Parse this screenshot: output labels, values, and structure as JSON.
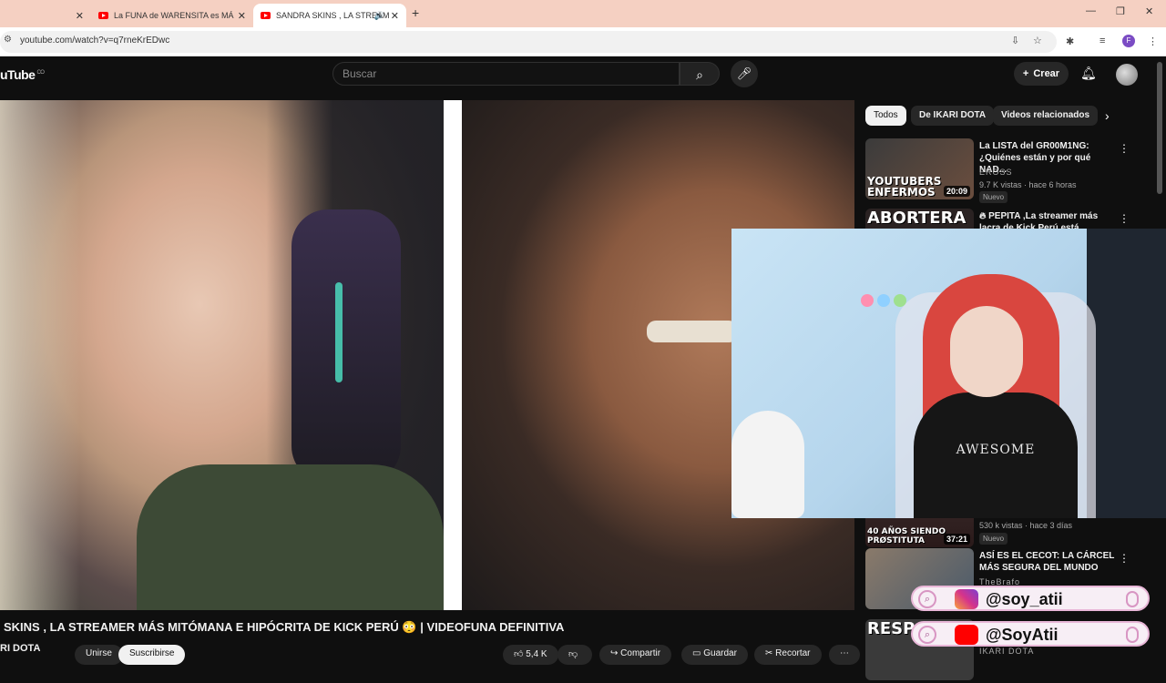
{
  "browser": {
    "tabs": [
      {
        "title": "La FUNA de WARENSITA es MÁ"
      },
      {
        "title": "SANDRA SKINS , LA STREAM"
      }
    ],
    "url": "youtube.com/watch?v=q7rneKrEDwc",
    "profile_initial": "F"
  },
  "header": {
    "logo": "uTube",
    "country": "CO",
    "search_placeholder": "Buscar",
    "create_label": "Crear"
  },
  "video": {
    "title": "SKINS , LA STREAMER MÁS MITÓMANA E HIPÓCRITA DE KICK PERÚ 😳 | VIDEOFUNA DEFINITIVA",
    "channel": "RI DOTA",
    "join_label": "Unirse",
    "subscribe_label": "Suscribirse",
    "likes": "5,4 K",
    "share_label": "Compartir",
    "save_label": "Guardar",
    "clip_label": "Recortar",
    "webcam_shirt_text": "AWESOME"
  },
  "chips": [
    {
      "label": "Todos",
      "active": true
    },
    {
      "label": "De IKARI DOTA",
      "active": false
    },
    {
      "label": "Videos relacionados",
      "active": false
    }
  ],
  "recommendations": [
    {
      "title": "La LISTA del GR00M1NG: ¿Quiénes están y por qué NAD...",
      "channel": "EROSS",
      "meta": "9.7 K vistas · hace 6 horas",
      "badge": "Nuevo",
      "duration": "20:09",
      "thumb_text": "YOUTUBERS ENFERMOS",
      "thumb_color": "#5a4438"
    },
    {
      "title": "PEPITA ,La streamer más lacra de Kick Perú está",
      "channel": "",
      "meta": "",
      "badge": "",
      "duration": "",
      "thumb_text": "ABORTERA",
      "thumb_color": "#3a3030"
    },
    {
      "title": "",
      "channel": "",
      "meta": "530 k vistas · hace 3 días",
      "badge": "Nuevo",
      "duration": "37:21",
      "thumb_text": "40 AÑOS SIENDO PRØSTITUTA",
      "thumb_color": "#4a3535"
    },
    {
      "title": "ASÍ ES EL CECOT: LA CÁRCEL MÁS SEGURA DEL MUNDO",
      "channel": "TheBrafo",
      "meta": "",
      "badge": "",
      "duration": "",
      "thumb_text": "",
      "thumb_color": "#7a6a5a"
    },
    {
      "title": "",
      "channel": "IKARI DOTA",
      "meta": "",
      "badge": "",
      "duration": "",
      "thumb_text": "RESPO",
      "thumb_color": "#444"
    }
  ],
  "social": [
    {
      "network": "instagram",
      "handle": "@soy_atii",
      "color": "#d6338a"
    },
    {
      "network": "youtube",
      "handle": "@SoyAtii",
      "color": "#ff0000"
    }
  ],
  "icons": {
    "search": "search-icon",
    "mic": "mic-icon",
    "bell": "bell-icon",
    "plus": "plus-icon"
  }
}
